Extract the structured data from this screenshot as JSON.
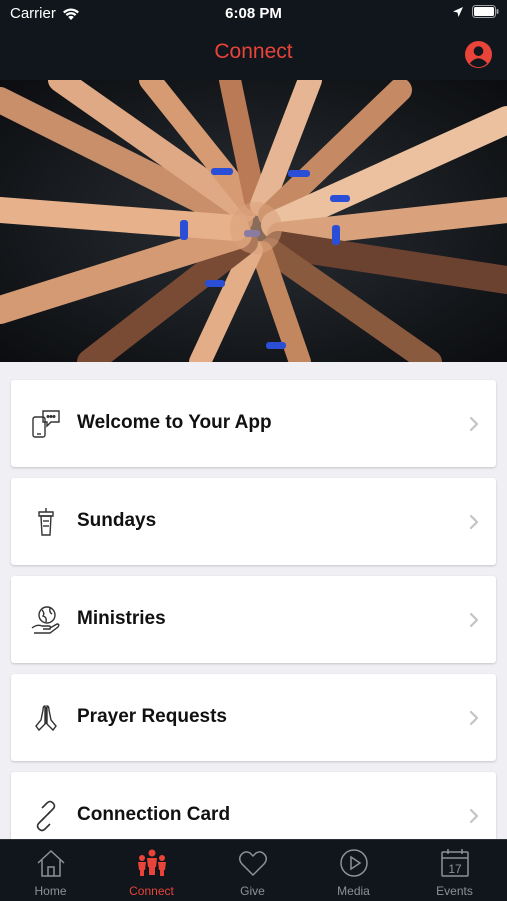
{
  "status_bar": {
    "carrier": "Carrier",
    "time": "6:08 PM"
  },
  "header": {
    "title": "Connect",
    "profile_icon": "user-icon"
  },
  "hero": {
    "description_icon": "hands-together-photo"
  },
  "colors": {
    "accent": "#e8443a",
    "bar_bg": "#10161b",
    "page_bg": "#efeff4"
  },
  "items": [
    {
      "label": "Welcome to Your App",
      "icon": "phone-chat-icon"
    },
    {
      "label": "Sundays",
      "icon": "podium-icon"
    },
    {
      "label": "Ministries",
      "icon": "globe-hand-icon"
    },
    {
      "label": "Prayer Requests",
      "icon": "praying-hands-icon"
    },
    {
      "label": "Connection Card",
      "icon": "link-icon"
    }
  ],
  "tabs": [
    {
      "label": "Home",
      "icon": "home-icon",
      "active": false
    },
    {
      "label": "Connect",
      "icon": "people-icon",
      "active": true
    },
    {
      "label": "Give",
      "icon": "heart-icon",
      "active": false
    },
    {
      "label": "Media",
      "icon": "play-icon",
      "active": false
    },
    {
      "label": "Events",
      "icon": "calendar-icon",
      "active": false,
      "calendar_day": "17"
    }
  ]
}
